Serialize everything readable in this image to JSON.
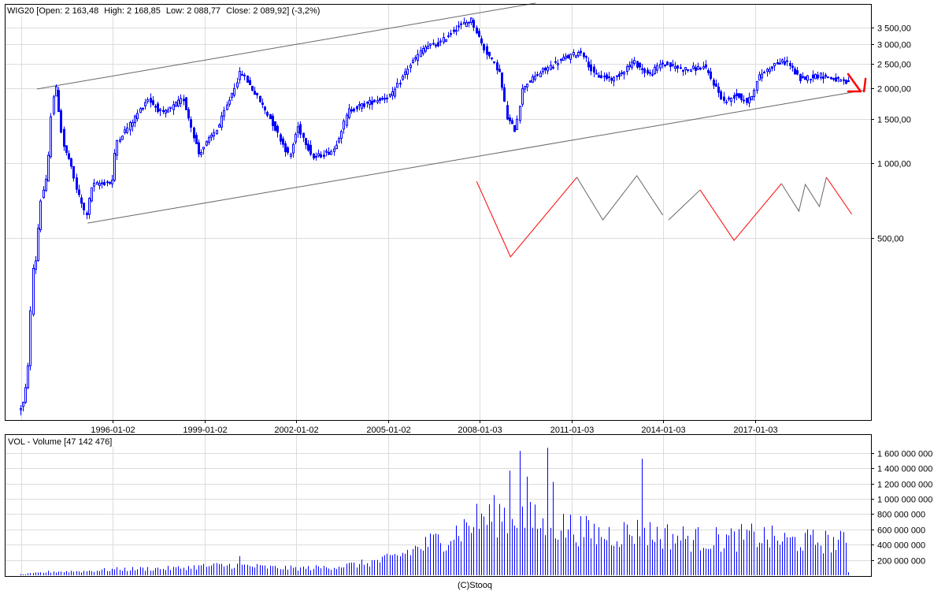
{
  "header": {
    "symbol": "WIG20",
    "open_label": "Open:",
    "open": "2 163,48",
    "high_label": "High:",
    "high": "2 168,85",
    "low_label": "Low:",
    "low": "2 088,77",
    "close_label": "Close:",
    "close": "2 089,92",
    "change": "(-3,2%)"
  },
  "volume_header": {
    "name": "VOL - Volume",
    "value": "[47 142 476]"
  },
  "copyright": "(C)Stooq",
  "colors": {
    "candle": "#0000ff",
    "zigzag_red": "#ff0000",
    "zigzag_grey": "#666666",
    "trendline": "#666666",
    "volume": "#0000ff",
    "annotation": "#ff0000"
  },
  "chart_data": [
    {
      "type": "candlestick",
      "title": "WIG20",
      "scale": "log",
      "interval": "monthly",
      "ylim": [
        95,
        4500
      ],
      "xlim": [
        1992.9,
        2021.1
      ],
      "grid": true,
      "y_ticks": [
        {
          "value": 500,
          "label": "500,00"
        },
        {
          "value": 1000,
          "label": "1 000,00"
        },
        {
          "value": 1500,
          "label": "1 500,00"
        },
        {
          "value": 2000,
          "label": "2 000,00"
        },
        {
          "value": 2500,
          "label": "2 500,00"
        },
        {
          "value": 3000,
          "label": "3 000,00"
        },
        {
          "value": 3500,
          "label": "3 500,00"
        }
      ],
      "x_grid_years": [
        1993,
        1996,
        1999,
        2002,
        2005,
        2008,
        2011,
        2014,
        2017
      ],
      "x_ticks": [
        {
          "year": 1996.0,
          "label": "1996-01-02"
        },
        {
          "year": 1999.0,
          "label": "1999-01-02"
        },
        {
          "year": 2002.0,
          "label": "2002-01-02"
        },
        {
          "year": 2005.0,
          "label": "2005-01-02"
        },
        {
          "year": 2008.0,
          "label": "2008-01-03"
        },
        {
          "year": 2011.0,
          "label": "2011-01-03"
        },
        {
          "year": 2014.0,
          "label": "2014-01-03"
        },
        {
          "year": 2017.0,
          "label": "2017-01-03"
        }
      ],
      "price_path": [
        [
          1992.92,
          101
        ],
        [
          1993.08,
          107
        ],
        [
          1993.2,
          129
        ],
        [
          1993.3,
          183
        ],
        [
          1993.38,
          365
        ],
        [
          1993.53,
          417
        ],
        [
          1993.63,
          679
        ],
        [
          1993.76,
          786
        ],
        [
          1993.89,
          890
        ],
        [
          1993.97,
          1409
        ],
        [
          1994.05,
          1820
        ],
        [
          1994.18,
          2000
        ],
        [
          1994.31,
          1409
        ],
        [
          1994.44,
          1130
        ],
        [
          1994.58,
          1050
        ],
        [
          1994.84,
          786
        ],
        [
          1995.15,
          610
        ],
        [
          1995.35,
          815
        ],
        [
          1996.0,
          845
        ],
        [
          1996.13,
          1217
        ],
        [
          1996.65,
          1460
        ],
        [
          1997.16,
          1820
        ],
        [
          1997.68,
          1570
        ],
        [
          1998.33,
          1820
        ],
        [
          1998.84,
          1090
        ],
        [
          1999.49,
          1410
        ],
        [
          2000.21,
          2350
        ],
        [
          2000.78,
          1820
        ],
        [
          2001.17,
          1515
        ],
        [
          2001.81,
          1050
        ],
        [
          2002.07,
          1410
        ],
        [
          2002.59,
          1050
        ],
        [
          2003.24,
          1130
        ],
        [
          2003.75,
          1630
        ],
        [
          2004.4,
          1750
        ],
        [
          2005.17,
          1890
        ],
        [
          2005.69,
          2430
        ],
        [
          2006.21,
          2920
        ],
        [
          2006.72,
          3030
        ],
        [
          2007.24,
          3500
        ],
        [
          2007.76,
          3770
        ],
        [
          2008.14,
          2920
        ],
        [
          2008.66,
          2350
        ],
        [
          2008.92,
          1515
        ],
        [
          2009.18,
          1360
        ],
        [
          2009.44,
          2030
        ],
        [
          2010.08,
          2350
        ],
        [
          2010.73,
          2620
        ],
        [
          2011.37,
          2820
        ],
        [
          2011.76,
          2260
        ],
        [
          2012.41,
          2180
        ],
        [
          2013.05,
          2560
        ],
        [
          2013.57,
          2260
        ],
        [
          2013.96,
          2520
        ],
        [
          2014.73,
          2380
        ],
        [
          2015.38,
          2430
        ],
        [
          2016.03,
          1750
        ],
        [
          2016.41,
          1890
        ],
        [
          2016.8,
          1750
        ],
        [
          2017.19,
          2260
        ],
        [
          2017.71,
          2520
        ],
        [
          2018.09,
          2560
        ],
        [
          2018.48,
          2180
        ],
        [
          2019.13,
          2260
        ],
        [
          2019.64,
          2180
        ],
        [
          2020.04,
          2090
        ]
      ],
      "trendlines": [
        {
          "name": "upper",
          "points": [
            [
              1993.51,
              1985
            ],
            [
              2009.82,
              4400
            ]
          ]
        },
        {
          "name": "lower",
          "points": [
            [
              1995.17,
              574
            ],
            [
              2020.57,
              1964
            ]
          ]
        }
      ],
      "zigzag": [
        {
          "color": "red",
          "points": [
            [
              2007.89,
              845
            ],
            [
              2009.0,
              420
            ],
            [
              2011.17,
              877
            ]
          ]
        },
        {
          "color": "grey",
          "points": [
            [
              2011.17,
              877
            ],
            [
              2012.02,
              591
            ],
            [
              2013.13,
              890
            ],
            [
              2013.98,
              618
            ]
          ]
        },
        {
          "color": "grey",
          "points": [
            [
              2014.17,
              591
            ],
            [
              2015.2,
              780
            ]
          ]
        },
        {
          "color": "red",
          "points": [
            [
              2015.2,
              780
            ],
            [
              2016.31,
              489
            ],
            [
              2017.86,
              827
            ]
          ]
        },
        {
          "color": "grey",
          "points": [
            [
              2017.86,
              827
            ],
            [
              2018.43,
              641
            ],
            [
              2018.64,
              821
            ],
            [
              2019.1,
              669
            ],
            [
              2019.33,
              877
            ]
          ]
        },
        {
          "color": "red",
          "points": [
            [
              2019.33,
              877
            ],
            [
              2020.16,
              623
            ]
          ]
        }
      ],
      "annotation_arrow": [
        [
          [
            2020.04,
            2281
          ],
          [
            2020.45,
            1942
          ]
        ],
        [
          [
            2020.04,
            1942
          ],
          [
            2020.45,
            1942
          ]
        ],
        [
          [
            2020.61,
            2184
          ],
          [
            2020.56,
            1942
          ]
        ]
      ]
    },
    {
      "type": "bar",
      "title": "VOL - Volume",
      "unit": "millions",
      "ylim": [
        0,
        1750
      ],
      "y_ticks": [
        {
          "value": 200,
          "label": "200 000 000"
        },
        {
          "value": 400,
          "label": "400 000 000"
        },
        {
          "value": 600,
          "label": "600 000 000"
        },
        {
          "value": 800,
          "label": "800 000 000"
        },
        {
          "value": 1000,
          "label": "1 000 000 000"
        },
        {
          "value": 1200,
          "label": "1 200 000 000"
        },
        {
          "value": 1400,
          "label": "1 400 000 000"
        },
        {
          "value": 1600,
          "label": "1 600 000 000"
        }
      ],
      "yearly_level": [
        [
          1993,
          12
        ],
        [
          1994,
          50
        ],
        [
          1995,
          55
        ],
        [
          1996,
          80
        ],
        [
          1997,
          90
        ],
        [
          1998,
          95
        ],
        [
          1999,
          125
        ],
        [
          2000,
          140
        ],
        [
          2001,
          110
        ],
        [
          2002,
          95
        ],
        [
          2003,
          110
        ],
        [
          2004,
          150
        ],
        [
          2005,
          220
        ],
        [
          2006,
          380
        ],
        [
          2007,
          550
        ],
        [
          2008,
          780
        ],
        [
          2009,
          850
        ],
        [
          2010,
          700
        ],
        [
          2011,
          650
        ],
        [
          2012,
          550
        ],
        [
          2013,
          600
        ],
        [
          2014,
          550
        ],
        [
          2015,
          500
        ],
        [
          2016,
          490
        ],
        [
          2017,
          540
        ],
        [
          2018,
          470
        ],
        [
          2019,
          470
        ],
        [
          2020,
          450
        ]
      ],
      "spikes": [
        [
          2000.1,
          250
        ],
        [
          2009.0,
          1367
        ],
        [
          2009.3,
          1626
        ],
        [
          2009.55,
          1290
        ],
        [
          2010.2,
          1668
        ],
        [
          2010.4,
          1222
        ],
        [
          2013.3,
          1523
        ],
        [
          2020.04,
          40
        ]
      ]
    }
  ]
}
